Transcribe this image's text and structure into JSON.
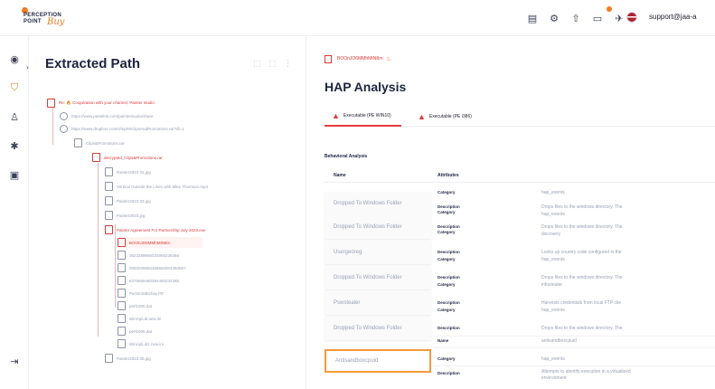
{
  "brand": {
    "line1": "PERCEPTION",
    "line2": "POINT",
    "script": "Buy",
    "accent": "#f47a1f"
  },
  "topbar": {
    "icons": [
      "document-icon",
      "settings-icon",
      "upload-icon",
      "chat-icon",
      "rocket-icon"
    ],
    "user_email": "support@jaa-a"
  },
  "left_panel": {
    "title": "Extracted Path",
    "tools": "⬚ ⬚ ⋮",
    "tree": [
      {
        "label": "Re: 🔥 Cooperation with your channel, Painter studio",
        "type": "email"
      },
      {
        "label": "https://www.pastebin.com/painterstudio/share",
        "type": "url"
      },
      {
        "label": "https://www.dropbox.com/s/3y29/ClipsAndPromotions.rar?dl=1",
        "type": "url"
      },
      {
        "label": "Clips&Promotions.rar",
        "type": "file"
      },
      {
        "label": "decrypted_Clips&Promotions.rar",
        "type": "file"
      },
      {
        "label": "Painter2023 02.jpg",
        "type": "file"
      },
      {
        "label": "Vertical Outside the Lines with Mike Thomson.mp4",
        "type": "file"
      },
      {
        "label": "Painter2023 03.jpg",
        "type": "file"
      },
      {
        "label": "Painter2023.jpg",
        "type": "file"
      },
      {
        "label": "Painter Agreement For Partnership July 2023.exe",
        "type": "file"
      },
      {
        "label": "BOOnJO6MMhMtN8rn",
        "type": "file"
      },
      {
        "label": "3823289665034956235466",
        "type": "file"
      },
      {
        "label": "0062049660485660004350687",
        "type": "file"
      },
      {
        "label": "8376669460384460234386",
        "type": "file"
      },
      {
        "label": "PerSmmBtchay.PE",
        "type": "file"
      },
      {
        "label": "perfc000.dat",
        "type": "file"
      },
      {
        "label": "WinApiLib.new.ini",
        "type": "file"
      },
      {
        "label": "perfc009.dat",
        "type": "file"
      },
      {
        "label": "WinApiLib1.new.ini",
        "type": "file"
      },
      {
        "label": "Painter2023 05.jpg",
        "type": "file"
      }
    ]
  },
  "content": {
    "crumb": "BOOnJO6MMhMtN8rn",
    "title": "HAP Analysis",
    "tabs": [
      "Executable (PE WIN10)",
      "Executable (PE i386)"
    ],
    "section_title": "Behavioral Analysis",
    "headers": {
      "name": "Name",
      "attributes": "Attributes"
    },
    "rows": [
      {
        "name": "Dropped To Windows Folder",
        "k1": "Category",
        "v1": "hap_events",
        "k2": "Description",
        "v2": "Drops files to the windows directory. The"
      },
      {
        "name": "Dropped To Windows Folder",
        "k1": "Category",
        "v1": "hap_events",
        "k2": "Description",
        "v2": "Drops files to the windows directory. The"
      },
      {
        "name": "Usergeoreg",
        "k1": "Category",
        "v1": "discovery",
        "k2": "Description",
        "v2": "Looks up country code configured in the"
      },
      {
        "name": "Dropped To Windows Folder",
        "k1": "Category",
        "v1": "hap_events",
        "k2": "Description",
        "v2": "Drops files to the windows directory. The"
      },
      {
        "name": "Pswstealer",
        "k1": "Category",
        "v1": "infostealer",
        "k2": "Description",
        "v2": "Harvests credentials from local FTP clie"
      },
      {
        "name": "Dropped To Windows Folder",
        "k1": "Category",
        "v1": "hap_events",
        "k2": "Description",
        "v2": "Drops files to the windows directory. The"
      },
      {
        "name": "Antisandboxcpuid",
        "k0": "Name",
        "v0": "antisandboxcpuid",
        "k1": "Category",
        "v1": "hap_events",
        "k2": "Description",
        "v2": "Attempts to identify execution in a virtualized environment"
      }
    ]
  }
}
